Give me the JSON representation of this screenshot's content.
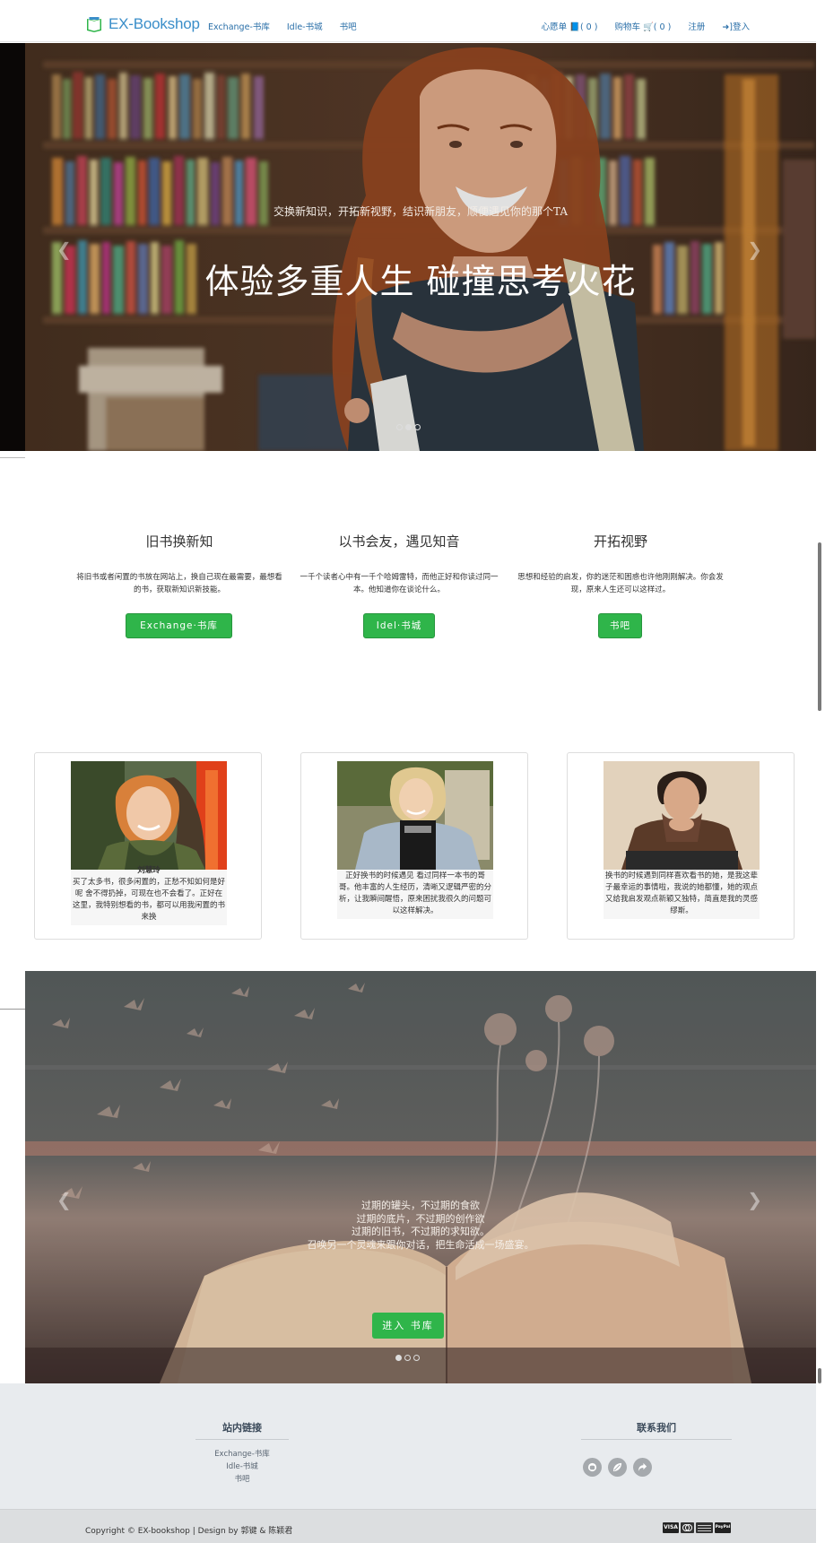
{
  "nav": {
    "brand": "EX-Bookshop",
    "links_left": [
      "Exchange-书库",
      "Idle-书城",
      "书吧"
    ],
    "wishlist": "心愿单 📘( 0 )",
    "cart": "购物车 🛒( 0 )",
    "register": "注册",
    "login": "➜]登入"
  },
  "hero": {
    "subtitle": "交换新知识，开拓新视野，结识新朋友，顺便遇见你的那个TA",
    "title": "体验多重人生  碰撞思考火花"
  },
  "features": [
    {
      "title": "旧书换新知",
      "text": "将旧书或者闲置的书放在网站上，换自己现在最需要，最想看的书，获取新知识新技能。",
      "button": "Exchange·书库"
    },
    {
      "title": "以书会友，遇见知音",
      "text": "一千个读者心中有一千个哈姆雷特，而他正好和你读过同一本。他知道你在谈论什么。",
      "button": "Idel·书城"
    },
    {
      "title": "开拓视野",
      "text": "思想和经验的启发，你的迷茫和困惑也许他刚刚解决。你会发现，原来人生还可以这样过。",
      "button": "书吧"
    }
  ],
  "cards": [
    {
      "caption_top": "刘慧玲",
      "text": "买了太多书，很多闲置的，正愁不知如何是好呢 舍不得扔掉，可现在也不会看了。正好在这里，我特别想看的书，都可以用我闲置的书来换"
    },
    {
      "text": "正好换书的时候遇见 看过同样一本书的哥哥。他丰富的人生经历，清晰又逻辑严密的分析，让我瞬间醒悟，原来困扰我很久的问题可以这样解决。"
    },
    {
      "text": "换书的时候遇到同样喜欢看书的她，是我这辈子最幸运的事情啦，我说的她都懂，她的观点又给我启发观点新颖又独特，简直是我的灵感缪斯。"
    }
  ],
  "hero2": {
    "lines": [
      "过期的罐头，不过期的食欲",
      "过期的底片，不过期的创作欲",
      "过期的旧书，不过期的求知欲。",
      "召唤另一个灵魂来跟你对话，把生命活成一场盛宴。"
    ],
    "button": "进入 书库"
  },
  "footer": {
    "links_title": "站内链接",
    "links": [
      "Exchange-书库",
      "Idle-书城",
      "书吧"
    ],
    "contact_title": "联系我们",
    "social_icons": [
      "github-icon",
      "leaf-icon",
      "share-icon"
    ],
    "copyright": "Copyright © EX-bookshop | Design by 郭键 & 陈颖君",
    "payments": [
      "VISA",
      "MC",
      "AMEX",
      "PayPal"
    ]
  }
}
